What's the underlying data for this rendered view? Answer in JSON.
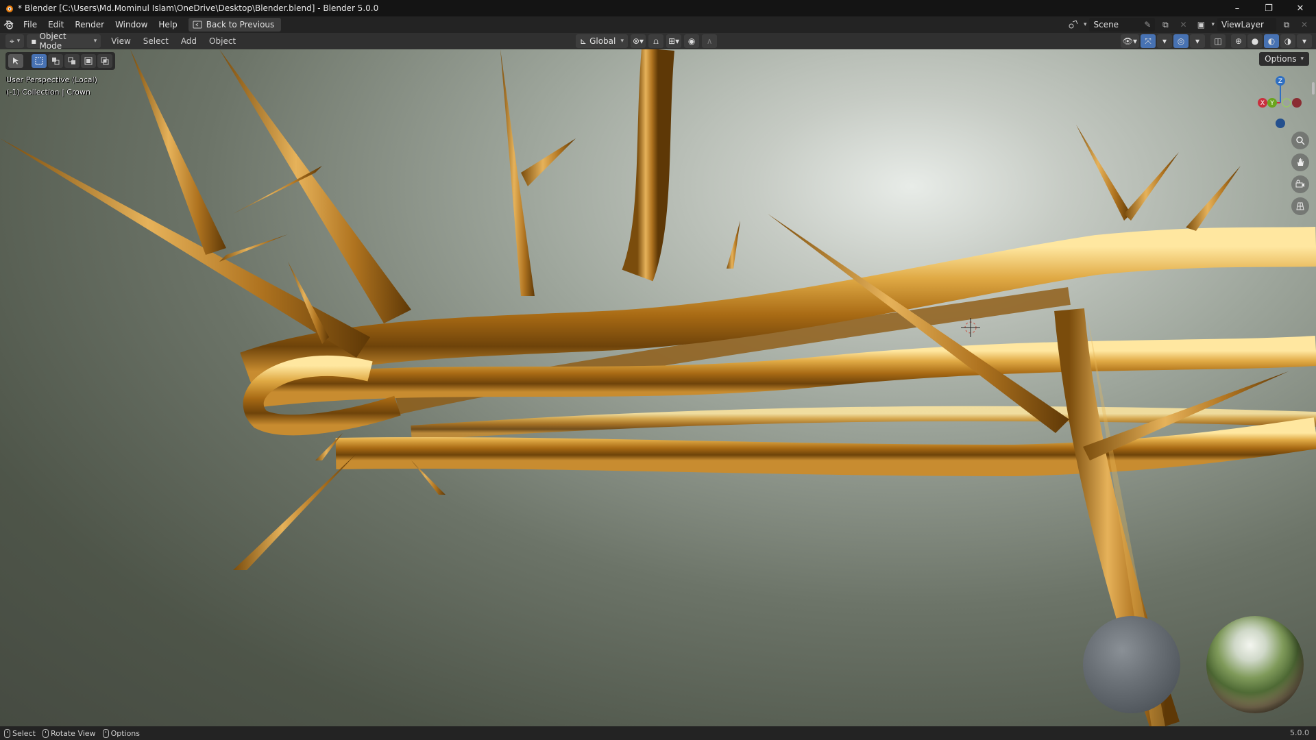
{
  "window": {
    "title": "* Blender [C:\\Users\\Md.Mominul Islam\\OneDrive\\Desktop\\Blender.blend] - Blender 5.0.0",
    "controls": {
      "minimize": "–",
      "maximize": "❐",
      "close": "✕"
    }
  },
  "menubar": {
    "items": [
      "File",
      "Edit",
      "Render",
      "Window",
      "Help"
    ],
    "back_button": "Back to Previous",
    "scene": "Scene",
    "view_layer": "ViewLayer"
  },
  "viewport_header": {
    "mode": "Object Mode",
    "menus": [
      "View",
      "Select",
      "Add",
      "Object"
    ],
    "transform_orientation": "Global"
  },
  "viewport": {
    "perspective_label": "User Perspective (Local)",
    "collection_label": "(-1) Collection | Crown",
    "options_label": "Options",
    "gizmo_axes": {
      "z": "Z",
      "y": "Y",
      "x": "X"
    }
  },
  "statusbar": {
    "items": [
      "Select",
      "Rotate View",
      "Options"
    ],
    "version": "5.0.0"
  },
  "colors": {
    "accent": "#4772b3",
    "axis_x": "#c8303e",
    "axis_y": "#6aa51e",
    "axis_z": "#2f6fc2",
    "gold": "#c8922a"
  }
}
